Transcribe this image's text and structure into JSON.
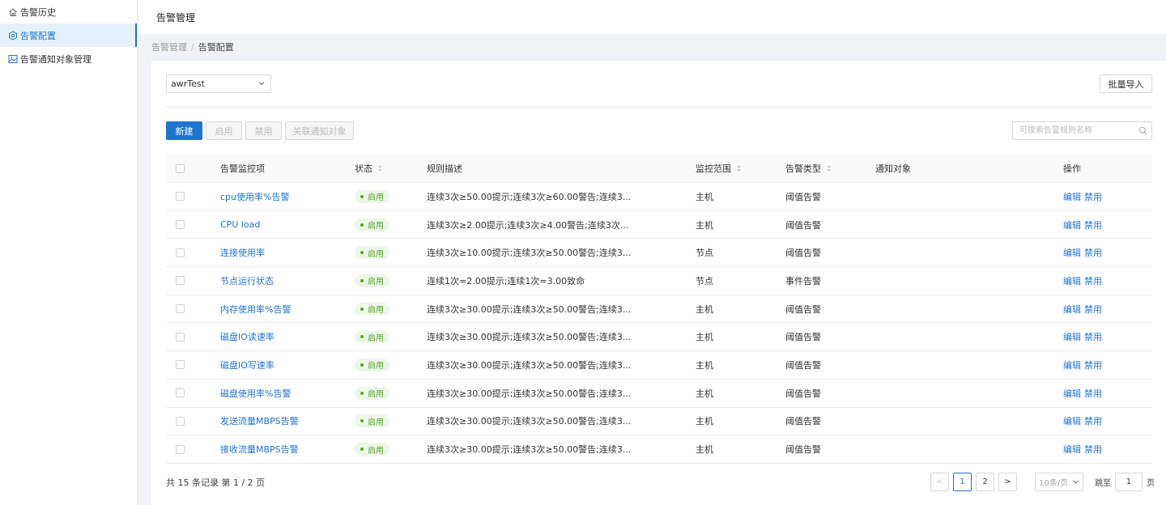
{
  "sidebar": {
    "items": [
      {
        "label": "告警历史",
        "icon": "home-icon",
        "active": false
      },
      {
        "label": "告警配置",
        "icon": "settings-icon",
        "active": true
      },
      {
        "label": "告警通知对象管理",
        "icon": "image-icon",
        "active": false
      }
    ]
  },
  "header": {
    "title": "告警管理"
  },
  "breadcrumb": {
    "parent": "告警管理",
    "separator": "/",
    "current": "告警配置"
  },
  "filter": {
    "selected": "awrTest"
  },
  "actions": {
    "import_label": "批量导入"
  },
  "toolbar": {
    "new_label": "新建",
    "enable_label": "启用",
    "disable_label": "禁用",
    "link_notify_label": "关联通知对象"
  },
  "search": {
    "placeholder": "可搜索告警规则名称"
  },
  "table": {
    "columns": {
      "name": "告警监控项",
      "status": "状态",
      "desc": "规则描述",
      "scope": "监控范围",
      "type": "告警类型",
      "notify": "通知对象",
      "ops": "操作"
    },
    "rows": [
      {
        "name": "cpu使用率%告警",
        "status": "启用",
        "desc": "连续3次≥50.00提示;连续3次≥60.00警告;连续3...",
        "scope": "主机",
        "type": "阈值告警",
        "notify": "",
        "edit": "编辑",
        "disable": "禁用"
      },
      {
        "name": "CPU load",
        "status": "启用",
        "desc": "连续3次≥2.00提示;连续3次≥4.00警告;连续3次...",
        "scope": "主机",
        "type": "阈值告警",
        "notify": "",
        "edit": "编辑",
        "disable": "禁用"
      },
      {
        "name": "连接使用率",
        "status": "启用",
        "desc": "连续3次≥10.00提示;连续3次≥50.00警告;连续3...",
        "scope": "节点",
        "type": "阈值告警",
        "notify": "",
        "edit": "编辑",
        "disable": "禁用"
      },
      {
        "name": "节点运行状态",
        "status": "启用",
        "desc": "连续1次=2.00提示;连续1次=3.00致命",
        "scope": "节点",
        "type": "事件告警",
        "notify": "",
        "edit": "编辑",
        "disable": "禁用"
      },
      {
        "name": "内存使用率%告警",
        "status": "启用",
        "desc": "连续3次≥30.00提示;连续3次≥50.00警告;连续3...",
        "scope": "主机",
        "type": "阈值告警",
        "notify": "",
        "edit": "编辑",
        "disable": "禁用"
      },
      {
        "name": "磁盘IO读速率",
        "status": "启用",
        "desc": "连续3次≥30.00提示;连续3次≥50.00警告;连续3...",
        "scope": "主机",
        "type": "阈值告警",
        "notify": "",
        "edit": "编辑",
        "disable": "禁用"
      },
      {
        "name": "磁盘IO写速率",
        "status": "启用",
        "desc": "连续3次≥30.00提示;连续3次≥50.00警告;连续3...",
        "scope": "主机",
        "type": "阈值告警",
        "notify": "",
        "edit": "编辑",
        "disable": "禁用"
      },
      {
        "name": "磁盘使用率%告警",
        "status": "启用",
        "desc": "连续3次≥30.00提示;连续3次≥50.00警告;连续3...",
        "scope": "主机",
        "type": "阈值告警",
        "notify": "",
        "edit": "编辑",
        "disable": "禁用"
      },
      {
        "name": "发送流量MBPS告警",
        "status": "启用",
        "desc": "连续3次≥30.00提示;连续3次≥50.00警告;连续3...",
        "scope": "主机",
        "type": "阈值告警",
        "notify": "",
        "edit": "编辑",
        "disable": "禁用"
      },
      {
        "name": "接收流量MBPS告警",
        "status": "启用",
        "desc": "连续3次≥30.00提示;连续3次≥50.00警告;连续3...",
        "scope": "主机",
        "type": "阈值告警",
        "notify": "",
        "edit": "编辑",
        "disable": "禁用"
      }
    ]
  },
  "pagination": {
    "summary": "共 15 条记录 第 1 / 2 页",
    "prev": "<",
    "pages": [
      "1",
      "2"
    ],
    "current_page": "1",
    "next": ">",
    "page_size": "10条/页",
    "jump_label": "跳至",
    "jump_value": "1",
    "page_unit": "页"
  },
  "colors": {
    "primary": "#1f74d0",
    "success": "#52a829",
    "success_bg": "#eef6e9"
  }
}
